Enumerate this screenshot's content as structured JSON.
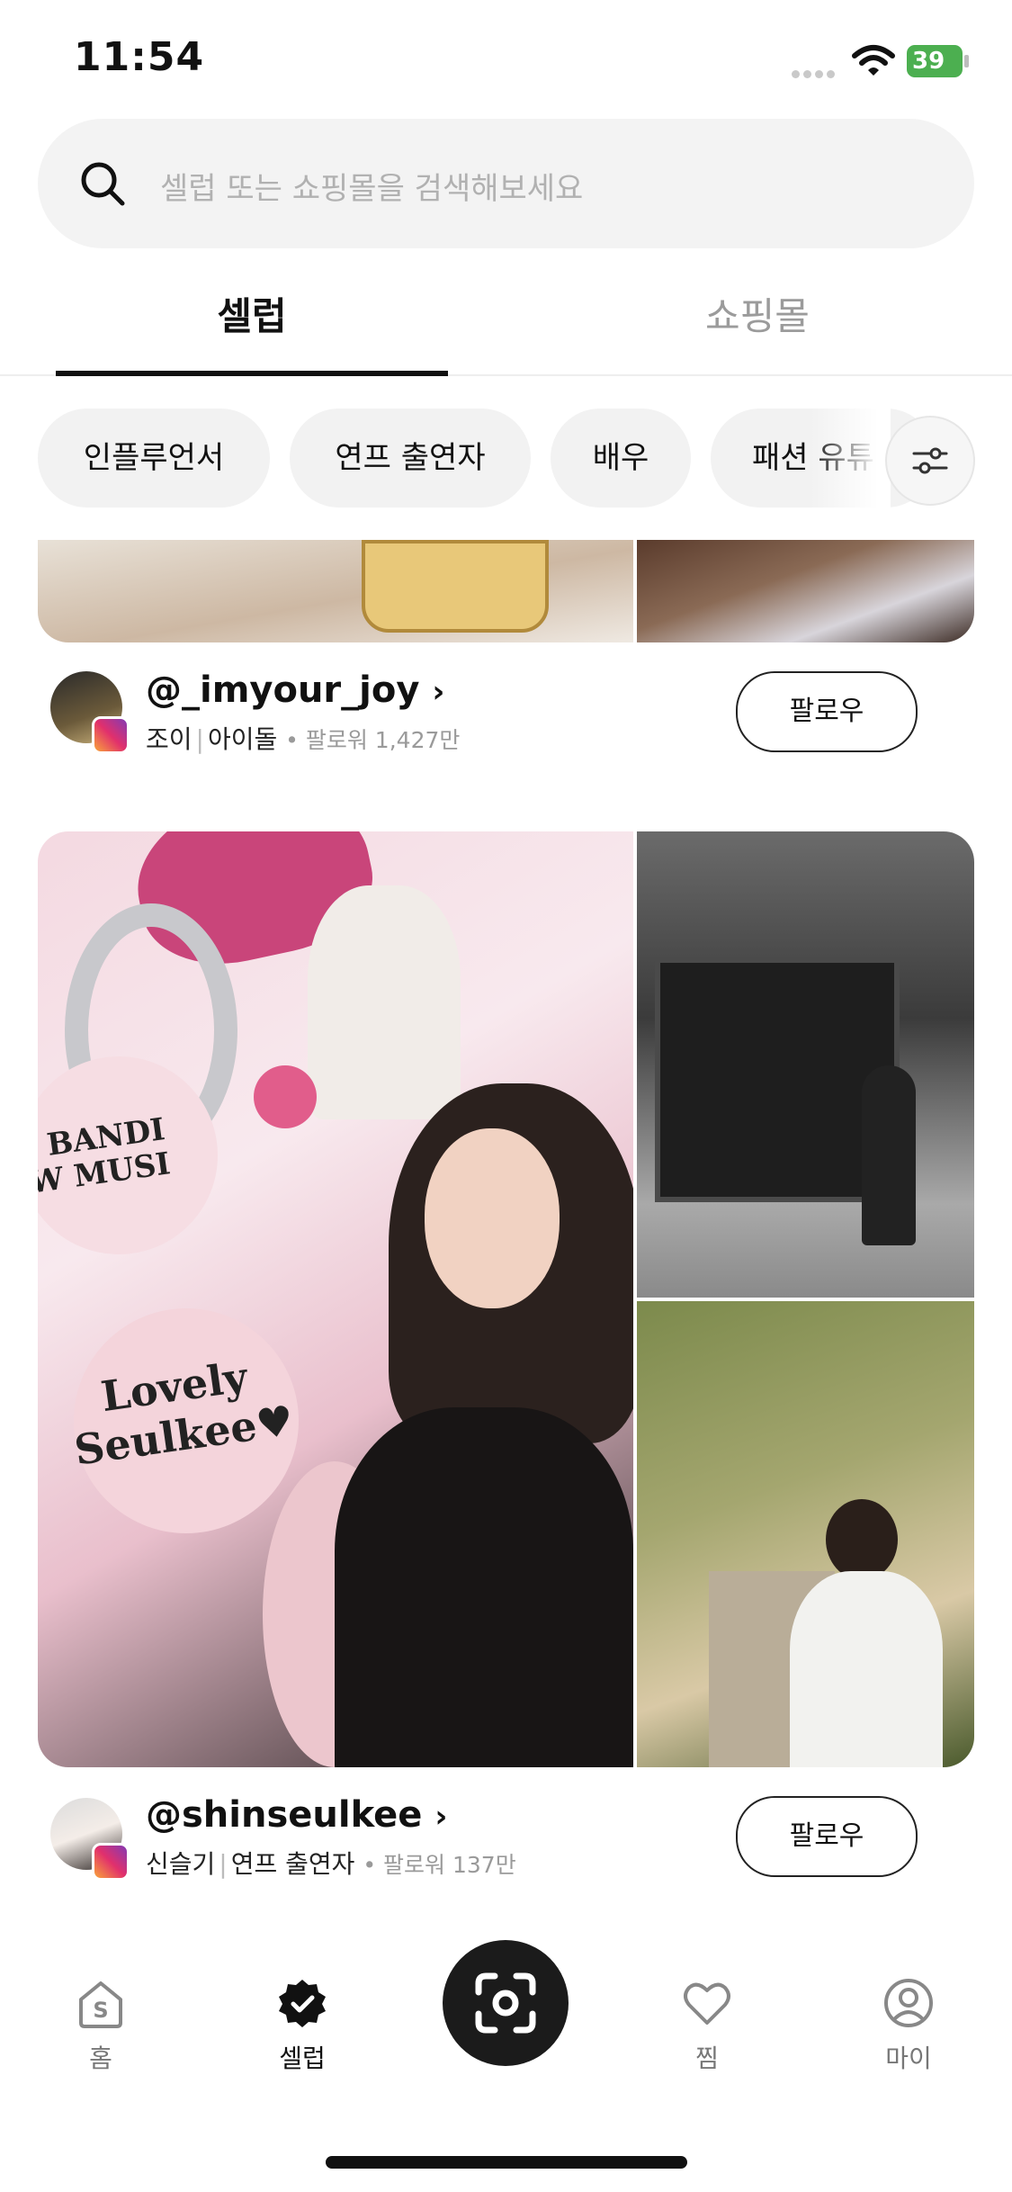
{
  "status_bar": {
    "time": "11:54",
    "battery": "39"
  },
  "search": {
    "placeholder": "셀럽 또는 쇼핑몰을 검색해보세요"
  },
  "tabs": [
    {
      "label": "셀럽",
      "active": true
    },
    {
      "label": "쇼핑몰",
      "active": false
    }
  ],
  "chips": [
    "인플루언서",
    "연프 출연자",
    "배우",
    "패션 유튜"
  ],
  "celebs": [
    {
      "handle": "@_imyour_joy",
      "name": "조이",
      "category": "아이돌",
      "followers": "팔로워 1,427만",
      "follow_label": "팔로우"
    },
    {
      "handle": "@shinseulkee",
      "name": "신슬기",
      "category": "연프 출연자",
      "followers": "팔로워 137만",
      "follow_label": "팔로우",
      "photo_text": {
        "top": "BANDI",
        "mid": "W MUSI",
        "line1": "Lovely",
        "line2": "Seulkee♥"
      }
    }
  ],
  "bottom_nav": [
    {
      "label": "홈",
      "icon": "home-icon",
      "active": false
    },
    {
      "label": "셀럽",
      "icon": "celeb-badge-icon",
      "active": true
    },
    {
      "label": "",
      "icon": "camera-scan-icon",
      "active": false
    },
    {
      "label": "찜",
      "icon": "heart-icon",
      "active": false
    },
    {
      "label": "마이",
      "icon": "profile-icon",
      "active": false
    }
  ]
}
